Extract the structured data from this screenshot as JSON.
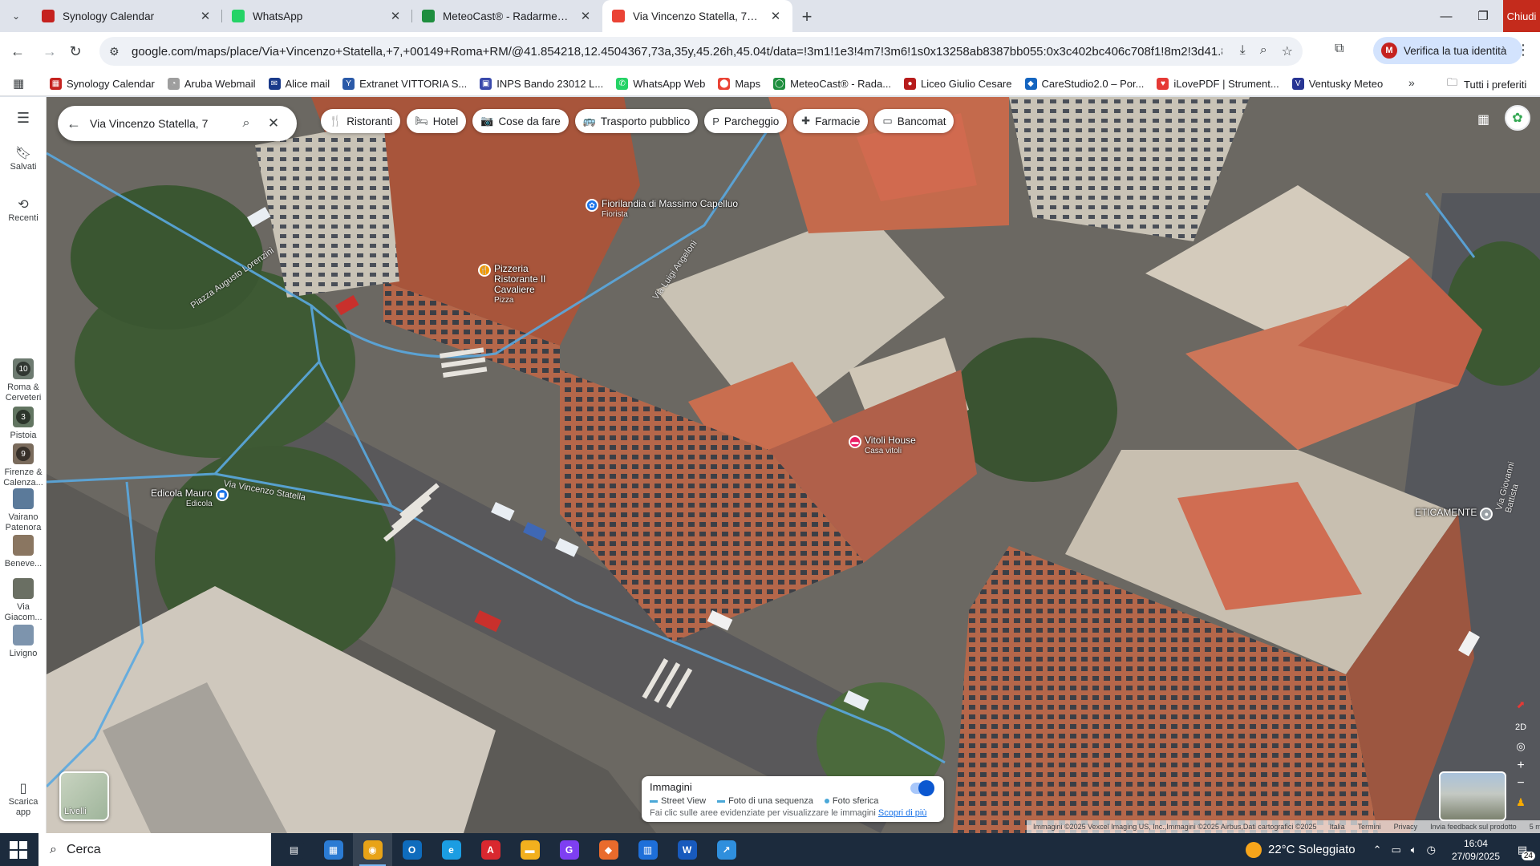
{
  "tabs": [
    {
      "title": "Synology Calendar",
      "icon": "calendar-icon",
      "color": "#c5221f"
    },
    {
      "title": "WhatsApp",
      "icon": "whatsapp-icon",
      "color": "#25d366"
    },
    {
      "title": "MeteoCast® - Radarmeteo",
      "icon": "meteocast-icon",
      "color": "#1e8e3e"
    },
    {
      "title": "Via Vincenzo Statella, 7 - Googl",
      "icon": "maps-pin-icon",
      "color": "#ea4335",
      "active": true
    }
  ],
  "window": {
    "close_label": "Chiudi"
  },
  "address_bar": {
    "url": "google.com/maps/place/Via+Vincenzo+Statella,+7,+00149+Roma+RM/@41.854218,12.4504367,73a,35y,45.26h,45.04t/data=!3m1!1e3!4m7!3m6!1s0x13258ab8387bb055:0x3c402bc406c708f1!8m2!3d41.8545248!4d12.4509...",
    "profile_label": "Verifica la tua identità",
    "profile_initial": "M"
  },
  "bookmarks": [
    {
      "label": "Synology Calendar",
      "color": "#c5221f",
      "glyph": "▦"
    },
    {
      "label": "Aruba Webmail",
      "color": "#9e9e9e",
      "glyph": "◔"
    },
    {
      "label": "Alice mail",
      "color": "#1a3a8a",
      "glyph": "✉"
    },
    {
      "label": "Extranet VITTORIA S...",
      "color": "#2b5aa8",
      "glyph": "Y"
    },
    {
      "label": "INPS Bando 23012 L...",
      "color": "#3949ab",
      "glyph": "▣"
    },
    {
      "label": "WhatsApp Web",
      "color": "#25d366",
      "glyph": "✆"
    },
    {
      "label": "Maps",
      "color": "#ea4335",
      "glyph": "⬤"
    },
    {
      "label": "MeteoCast® - Rada...",
      "color": "#1e8e3e",
      "glyph": "◯"
    },
    {
      "label": "Liceo Giulio Cesare",
      "color": "#b71c1c",
      "glyph": "●"
    },
    {
      "label": "CareStudio2.0 – Por...",
      "color": "#1565c0",
      "glyph": "◆"
    },
    {
      "label": "iLovePDF | Strument...",
      "color": "#e53935",
      "glyph": "♥"
    },
    {
      "label": "Ventusky Meteo",
      "color": "#283593",
      "glyph": "V"
    }
  ],
  "bookmarks_all": "Tutti i preferiti",
  "rail": {
    "saved": "Salvati",
    "recent": "Recenti",
    "history": [
      {
        "label": "Roma & Cerveteri",
        "badge": "10",
        "color": "#6d7a70"
      },
      {
        "label": "Pistoia",
        "badge": "3",
        "color": "#627561"
      },
      {
        "label": "Firenze & Calenza...",
        "badge": "9",
        "color": "#7a6b5c"
      },
      {
        "label": "Vairano Patenora",
        "badge": "",
        "color": "#5b7a9a"
      },
      {
        "label": "Benevе...",
        "badge": "",
        "color": "#8a7661"
      },
      {
        "label": "Via Giacom...",
        "badge": "",
        "color": "#6a6f63"
      },
      {
        "label": "Livigno",
        "badge": "",
        "color": "#7d94ad"
      }
    ],
    "download": "Scarica app"
  },
  "search": {
    "value": "Via Vincenzo Statella, 7"
  },
  "chips": [
    {
      "label": "Ristoranti",
      "icon": "restaurant-icon",
      "glyph": "🍴"
    },
    {
      "label": "Hotel",
      "icon": "hotel-icon",
      "glyph": "🛏"
    },
    {
      "label": "Cose da fare",
      "icon": "camera-icon",
      "glyph": "📷"
    },
    {
      "label": "Trasporto pubblico",
      "icon": "bus-icon",
      "glyph": "🚌"
    },
    {
      "label": "Parcheggio",
      "icon": "parking-icon",
      "glyph": "P"
    },
    {
      "label": "Farmacie",
      "icon": "pharmacy-icon",
      "glyph": "✚"
    },
    {
      "label": "Bancomat",
      "icon": "atm-icon",
      "glyph": "▭"
    }
  ],
  "pins": [
    {
      "label": "Fiorilandia di Massimo Capelluo",
      "sub": "Fiorista",
      "color": "#1a73e8"
    },
    {
      "label": "Pizzeria Ristorante Il Cavaliere",
      "sub": "Pizza",
      "color": "#f29900"
    },
    {
      "label": "Vitoli House",
      "sub": "Casa vitoli",
      "color": "#e91e63"
    },
    {
      "label": "Edicola Mauro",
      "sub": "Edicola",
      "color": "#1a73e8"
    },
    {
      "label": "ETICAMENTE",
      "sub": "",
      "color": "#9aa0a6"
    }
  ],
  "street_labels": [
    "Piazza Augusto Lorenzini",
    "Via Vincenzo Statella",
    "Via Luigi Angeloni",
    "Via Giovanni Battista"
  ],
  "layers_label": "Livelli",
  "imagery": {
    "title": "Immagini",
    "street_view": "Street View",
    "sequence": "Foto di una sequenza",
    "spherical": "Foto sferica",
    "hint": "Fai clic sulle aree evidenziate per visualizzare le immagini",
    "learn_more": "Scopri di più"
  },
  "controls": {
    "view_2d": "2D"
  },
  "footer": {
    "credits": "Immagini ©2025 Vexcel Imaging US, Inc.,Immagini ©2025 Airbus,Dati cartografici ©2025",
    "country": "Italia",
    "terms": "Termini",
    "privacy": "Privacy",
    "feedback": "Invia feedback sul prodotto",
    "scale": "5 m"
  },
  "taskbar": {
    "search_placeholder": "Cerca",
    "apps": [
      {
        "name": "task-view-icon",
        "glyph": "▤",
        "color": "#1c2b3d"
      },
      {
        "name": "store-icon",
        "glyph": "▦",
        "color": "#2b7bd3"
      },
      {
        "name": "chrome-icon",
        "glyph": "◉",
        "color": "#e8a317",
        "active": true
      },
      {
        "name": "outlook-icon",
        "glyph": "O",
        "color": "#0f6cbd"
      },
      {
        "name": "edge-icon",
        "glyph": "e",
        "color": "#1b9de2"
      },
      {
        "name": "acrobat-icon",
        "glyph": "A",
        "color": "#d9282f"
      },
      {
        "name": "file-explorer-icon",
        "glyph": "▬",
        "color": "#f2b01e"
      },
      {
        "name": "app-purple-icon",
        "glyph": "G",
        "color": "#7e3ff2"
      },
      {
        "name": "app-drop-icon",
        "glyph": "◆",
        "color": "#e96b2c"
      },
      {
        "name": "document-icon",
        "glyph": "▥",
        "color": "#1e6fd9"
      },
      {
        "name": "word-icon",
        "glyph": "W",
        "color": "#185abd"
      },
      {
        "name": "app-chart-icon",
        "glyph": "↗",
        "color": "#2f8fdd"
      }
    ],
    "weather": "22°C  Soleggiato",
    "time": "16:04",
    "date": "27/09/2025",
    "notifications": "24"
  }
}
